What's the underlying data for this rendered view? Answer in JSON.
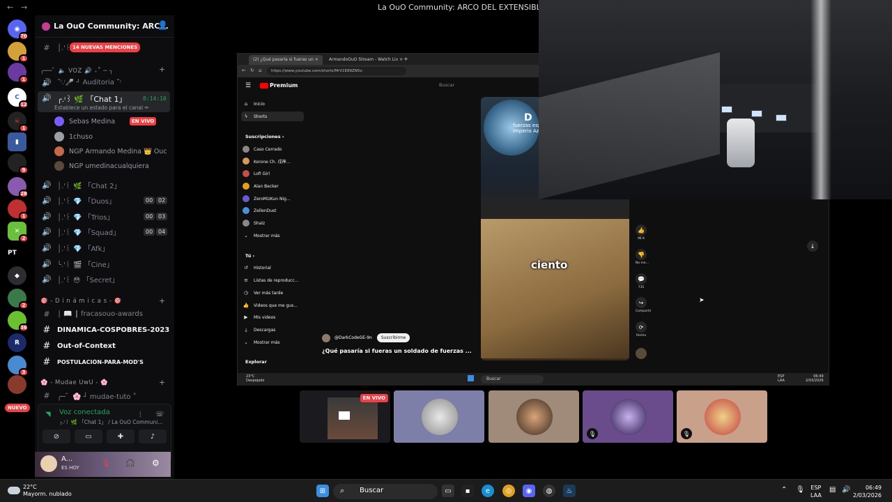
{
  "titlebar": {
    "title": "La OuO Community: ARCO DEL EXTENSIBLE",
    "back": "←",
    "forward": "→"
  },
  "server_rail": {
    "badges": [
      "70",
      "1",
      "1",
      "12",
      "1",
      "1",
      "1",
      "9",
      "28",
      "1",
      "2",
      "2",
      "36",
      "1",
      "3"
    ],
    "pt_label": "PT",
    "nuevo": "NUEVO"
  },
  "sidebar": {
    "server_name": "La OuO Community: ARC...",
    "mentions": "14 NUEVAS MENCIONES",
    "channels": [
      {
        "icon": "#",
        "label": "│.'꒰ 🔔 ꒱ ."
      },
      {
        "cat": "╭──゛🔈 VOZ 🔊 ₊˚ ─ ╮"
      },
      {
        "icon": "🔊",
        "label": "˚ᵎ.ᵎ🎤 ┘ Auditoria ˚ᵎ"
      },
      {
        "icon": "🔊",
        "label": "╭.ᵎ꒱ 🌿 「Chat 1」"
      },
      {
        "icon": "🔊",
        "label": "│.'꒰ 🌿 「Chat 2」"
      },
      {
        "icon": "🔊",
        "label": "│.'꒰ 💎 「Duos」"
      },
      {
        "icon": "🔊",
        "label": "│.'꒰ 💎 「Trios」"
      },
      {
        "icon": "🔊",
        "label": "│.'꒰ 💎 「Squad」"
      },
      {
        "icon": "🔊",
        "label": "│.'꒰ 💎 「Afk」"
      },
      {
        "icon": "🔊",
        "label": "╰.'꒰ 🎬 「Cine」"
      },
      {
        "icon": "🔊",
        "label": "│.'꒰ 😳 「Secret」"
      }
    ],
    "status_line": "Establece un estado para el canal ✏",
    "timer": "8:14:10",
    "voice_users": [
      {
        "name": "Sebas Medina",
        "color": "#7a5cff"
      },
      {
        "name": "1chuso",
        "color": "#9aa0a6"
      },
      {
        "name": "NGP Armando Medina 👑 Ouc",
        "color": "#c46a4a"
      },
      {
        "name": "NGP umedinacualquiera",
        "color": "#5a4a3a"
      }
    ],
    "live_badge": "EN VIVO",
    "counts": {
      "duos": [
        "00",
        "02"
      ],
      "trios": [
        "00",
        "03"
      ],
      "squad": [
        "00",
        "04"
      ]
    },
    "cat_dinamicas": "🎯 ‑ D i n á m i c a s ‑ 🎯",
    "dinamicas": [
      {
        "icon": "#",
        "label": "│ 📖 ┃ fracasouo-awards",
        "bold": false
      },
      {
        "icon": "#",
        "label": "DINAMICA-COSPOBRES-2023",
        "bold": true
      },
      {
        "icon": "#",
        "label": "Out-of-Context",
        "bold": true
      },
      {
        "icon": "#",
        "label": "POSTULACIÓN-PARA-MOD'S",
        "bold": true
      }
    ],
    "cat_mudae": "🌸 ‑ Mudae UwU ‑ 🌸",
    "mudae_channel": "╭─゛🌸 ┘ mudae-tuto ˚",
    "voice_panel": {
      "connected": "Voz conectada",
      "location": "╭.ᵎ꒱ 🌿 「Chat 1」 / La OuO Communi..."
    },
    "user": {
      "name": "A...",
      "status": "ES HOY"
    }
  },
  "browser": {
    "tabs": [
      {
        "label": "(2) ¿Qué pasaría si fueras un ×"
      },
      {
        "label": "ArmandoOuO Stream - Watch Liv ×"
      }
    ],
    "url": "https://www.youtube.com/shorts/MrV1E89ZN5o",
    "yt": {
      "logo": "Premium",
      "search": "Buscar",
      "nav": [
        {
          "icon": "⌂",
          "label": "Inicio"
        },
        {
          "icon": "ϟ",
          "label": "Shorts"
        }
      ],
      "subs_header": "Suscripciones ›",
      "subs": [
        {
          "label": "Caso Cerrado",
          "color": "#888"
        },
        {
          "label": "Korone Ch. 戌神...",
          "color": "#d29b5a"
        },
        {
          "label": "Lofi Girl",
          "color": "#c0504d"
        },
        {
          "label": "Alan Becker",
          "color": "#e0a020"
        },
        {
          "label": "ZeroMizKun Nig...",
          "color": "#6a5acd"
        },
        {
          "label": "ZellenDust",
          "color": "#4a90d9"
        },
        {
          "label": "Shalz",
          "color": "#888"
        }
      ],
      "more": "Mostrar más",
      "tu_header": "Tú ›",
      "tu": [
        {
          "icon": "↺",
          "label": "Historial"
        },
        {
          "icon": "≡",
          "label": "Listas de reproducc..."
        },
        {
          "icon": "◷",
          "label": "Ver más tarde"
        },
        {
          "icon": "👍",
          "label": "Videos que me gus..."
        },
        {
          "icon": "▶",
          "label": "Mis videos"
        },
        {
          "icon": "⤓",
          "label": "Descargas"
        },
        {
          "icon": "⌄",
          "label": "Mostrar más"
        }
      ],
      "explorar": "Explorar",
      "short": {
        "caption": "ciento",
        "top_caption": "fuerzas esp\nImperio Az",
        "dj": "D"
      },
      "channel": "@DarkCodeGE-9n",
      "subscribe": "Suscribirme",
      "video_title": "¿Qué pasaría si fueras un soldado de fuerzas ...",
      "actions": [
        {
          "icon": "👍",
          "label": "96 K"
        },
        {
          "icon": "👎",
          "label": "No me..."
        },
        {
          "icon": "💬",
          "label": "735"
        },
        {
          "icon": "↪",
          "label": "Compartir"
        },
        {
          "icon": "⟳",
          "label": "Remix"
        }
      ]
    },
    "inner_taskbar": {
      "weather": "23°C\nDespejado",
      "search": "Buscar",
      "lang": "ESP\nLAA",
      "clock": "06:49\n2/03/2026"
    }
  },
  "tiles": [
    {
      "type": "stream",
      "live": "EN VIVO"
    },
    {
      "type": "avatar",
      "bg": "#7d7fa8"
    },
    {
      "type": "avatar",
      "bg": "#a08a7a"
    },
    {
      "type": "avatar",
      "bg": "#6a4c8c",
      "muted": true
    },
    {
      "type": "avatar",
      "bg": "#c9a08a",
      "muted": true
    }
  ],
  "taskbar": {
    "weather": "22°C\nMayorm. nublado",
    "search": "Buscar",
    "lang": "ESP\nLAA",
    "clock": "06:49\n2/03/2026"
  }
}
